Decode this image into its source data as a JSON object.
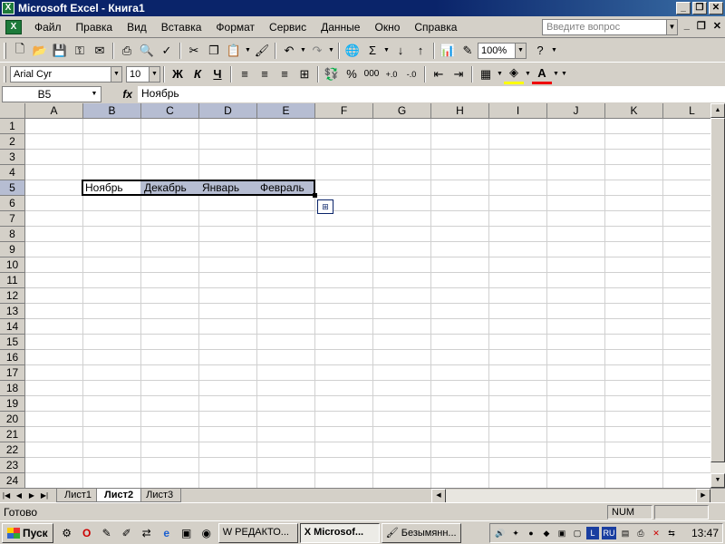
{
  "window": {
    "title": "Microsoft Excel - Книга1"
  },
  "menu": {
    "items": [
      "Файл",
      "Правка",
      "Вид",
      "Вставка",
      "Формат",
      "Сервис",
      "Данные",
      "Окно",
      "Справка"
    ],
    "help_placeholder": "Введите вопрос"
  },
  "toolbar": {
    "zoom": "100%",
    "font_name": "Arial Cyr",
    "font_size": "10",
    "percent": "%",
    "thousands": "000"
  },
  "formula_bar": {
    "name_box": "B5",
    "fx_label": "fx",
    "content": "Ноябрь"
  },
  "sheet": {
    "columns": [
      "A",
      "B",
      "C",
      "D",
      "E",
      "F",
      "G",
      "H",
      "I",
      "J",
      "K",
      "L"
    ],
    "rows": [
      "1",
      "2",
      "3",
      "4",
      "5",
      "6",
      "7",
      "8",
      "9",
      "10",
      "11",
      "12",
      "13",
      "14",
      "15",
      "16",
      "17",
      "18",
      "19",
      "20",
      "21",
      "22",
      "23",
      "24"
    ],
    "selected_columns": [
      "B",
      "C",
      "D",
      "E"
    ],
    "selected_row": "5",
    "cells": {
      "B5": "Ноябрь",
      "C5": "Декабрь",
      "D5": "Январь",
      "E5": "Февраль"
    }
  },
  "tabs": [
    "Лист1",
    "Лист2",
    "Лист3"
  ],
  "active_tab": "Лист2",
  "status": {
    "text": "Готово",
    "num": "NUM"
  },
  "taskbar": {
    "start": "Пуск",
    "buttons": [
      "РЕДАКТО...",
      "Microsof...",
      "Безымянн..."
    ],
    "tray_lang": "RU",
    "clock": "13:47"
  }
}
